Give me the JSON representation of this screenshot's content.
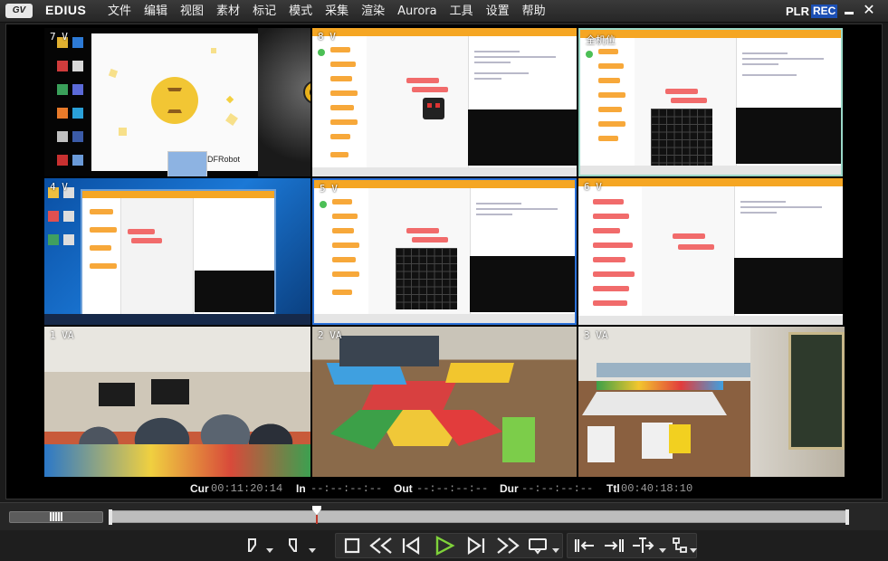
{
  "app": {
    "logo_text": "GV",
    "name": "EDIUS"
  },
  "menu": [
    "文件",
    "编辑",
    "视图",
    "素材",
    "标记",
    "模式",
    "采集",
    "渲染",
    "Aurora",
    "工具",
    "设置",
    "帮助"
  ],
  "mode": {
    "plr": "PLR",
    "rec": "REC",
    "active": "REC",
    "accent": "#1b4fb4"
  },
  "window_buttons": {
    "minimize": "minimize-icon",
    "close": "close-icon"
  },
  "multicam": {
    "cells": [
      {
        "label": "7 V",
        "content": "desktop-slide"
      },
      {
        "label": "8 V",
        "content": "mind-plus-robot"
      },
      {
        "label": "全机位",
        "content": "mind-plus-led-matrix",
        "selected": true
      },
      {
        "label": "4 V",
        "content": "win7-desktop"
      },
      {
        "label": "5 V",
        "content": "mind-plus-led-matrix"
      },
      {
        "label": "6 V",
        "content": "mind-plus-code"
      },
      {
        "label": "1 VA",
        "content": "classroom-students"
      },
      {
        "label": "2 VA",
        "content": "classroom-hexagon-tables"
      },
      {
        "label": "3 VA",
        "content": "classroom-wide"
      }
    ],
    "slide_logo_text": "DFRobot"
  },
  "timecodes": {
    "cur": {
      "label": "Cur",
      "value": "00:11:20:14"
    },
    "in": {
      "label": "In",
      "value": "--:--:--:--"
    },
    "out": {
      "label": "Out",
      "value": "--:--:--:--"
    },
    "dur": {
      "label": "Dur",
      "value": "--:--:--:--"
    },
    "ttl": {
      "label": "Ttl",
      "value": "00:40:18:10"
    }
  },
  "timeline": {
    "playhead_fraction": 0.281
  },
  "controls": [
    "mark-in-icon",
    "mark-out-icon",
    "stop-icon",
    "rewind-icon",
    "step-back-icon",
    "play-icon",
    "step-forward-icon",
    "fast-forward-icon",
    "loop-playback-icon",
    "insert-to-timeline-icon",
    "overwrite-to-timeline-icon",
    "split-icon",
    "sync-icon"
  ]
}
